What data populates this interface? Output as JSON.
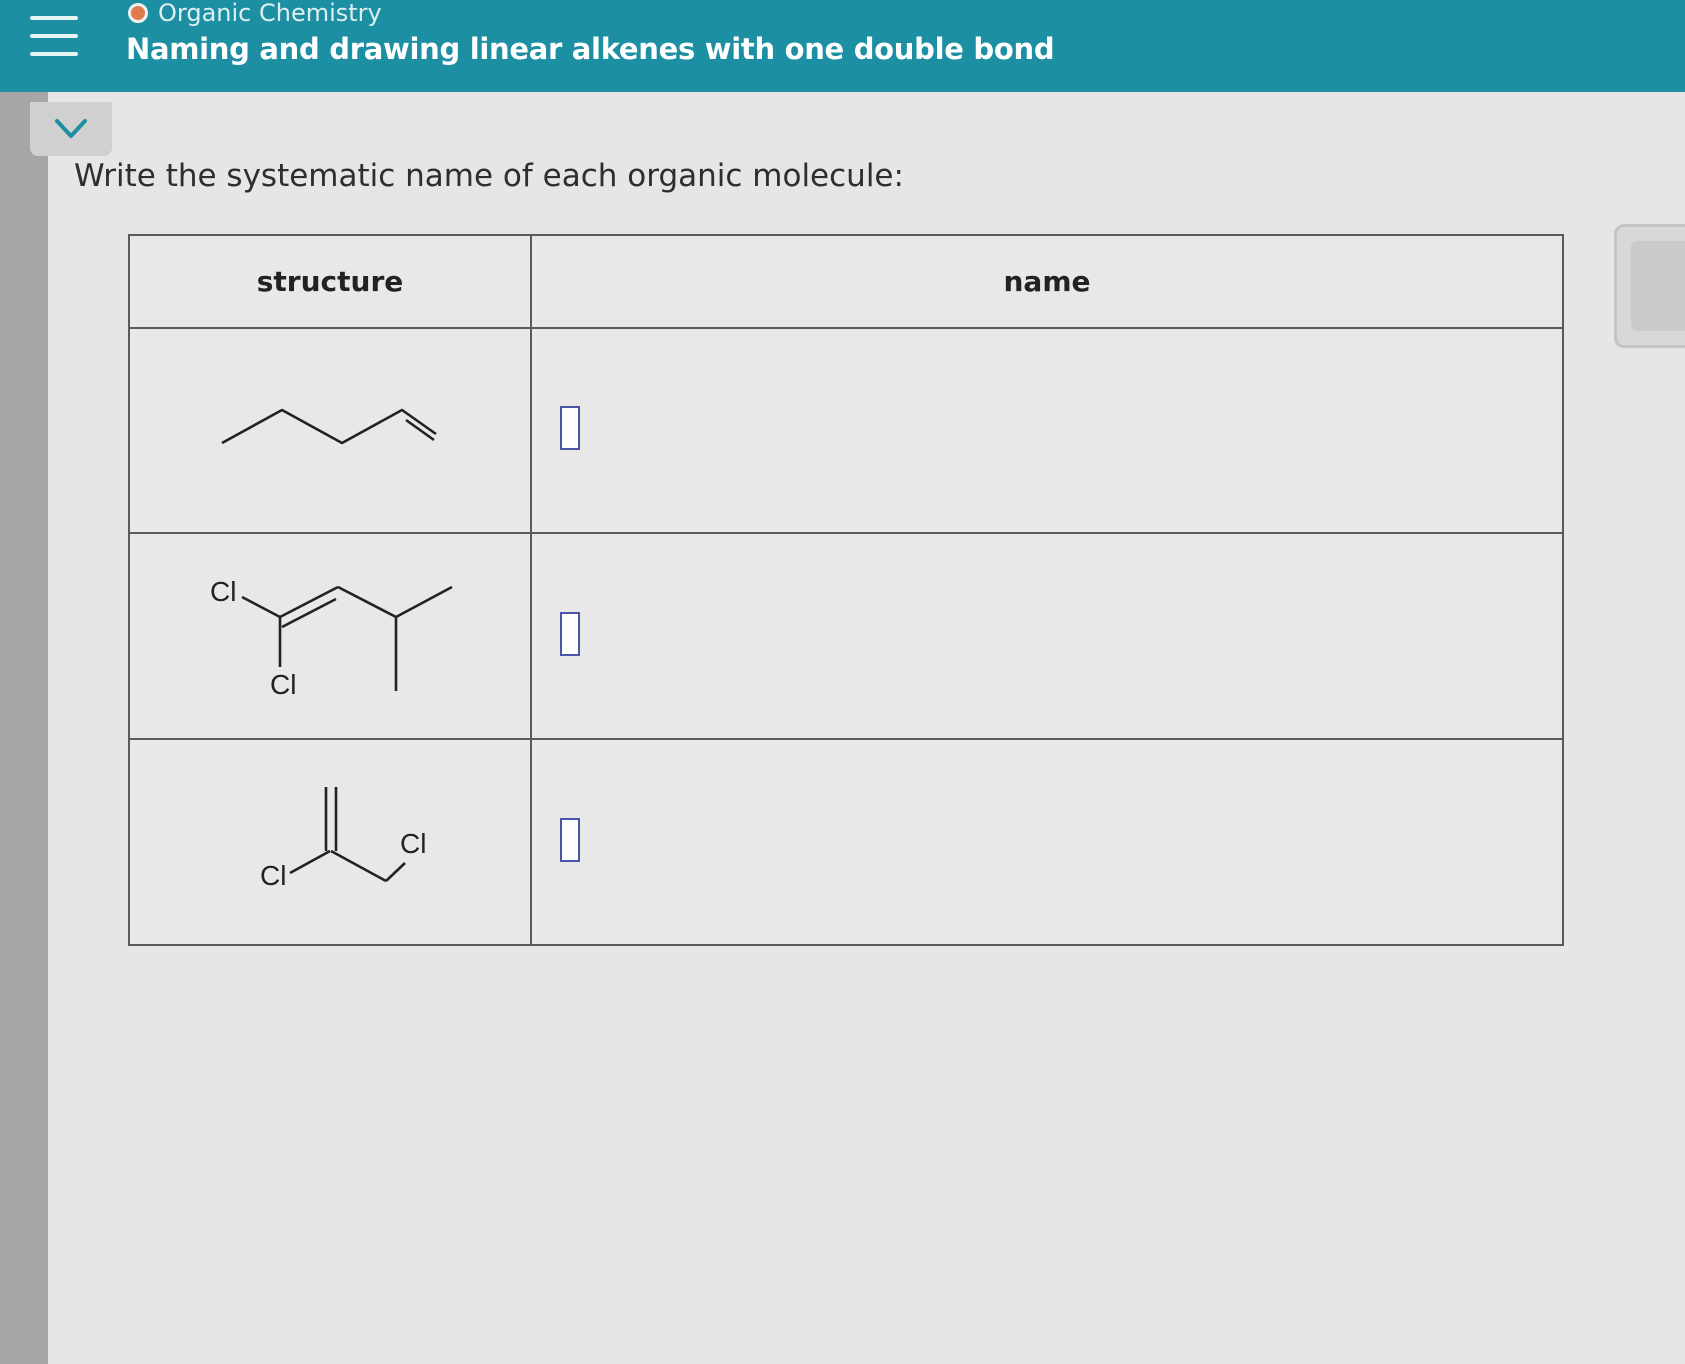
{
  "header": {
    "course": "Organic Chemistry",
    "topic": "Naming and drawing linear alkenes with one double bond"
  },
  "prompt": "Write the systematic name of each organic molecule:",
  "table": {
    "headers": {
      "structure": "structure",
      "name": "name"
    },
    "rows": [
      {
        "atoms": []
      },
      {
        "atoms": [
          "Cl",
          "Cl"
        ]
      },
      {
        "atoms": [
          "Cl",
          "Cl"
        ]
      }
    ]
  },
  "colors": {
    "header_bg": "#1d8fa3",
    "answer_box_border": "#4a55a5"
  }
}
